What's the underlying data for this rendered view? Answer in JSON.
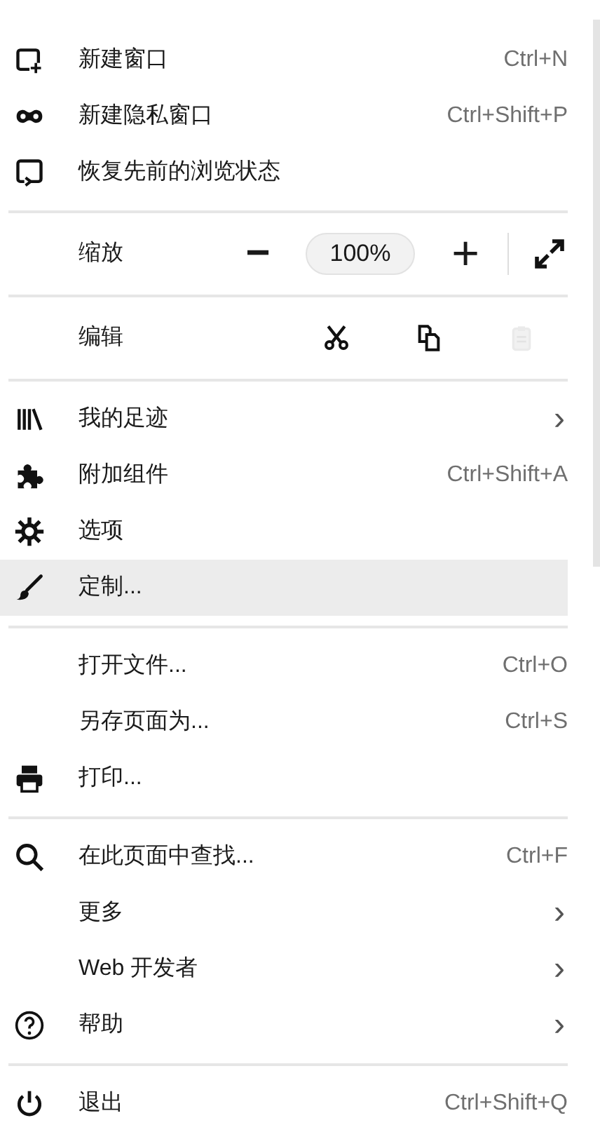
{
  "sections": [
    {
      "rows": [
        {
          "kind": "item",
          "label": "新建窗口",
          "shortcut": "Ctrl+N",
          "selected": false
        },
        {
          "kind": "item",
          "label": "新建隐私窗口",
          "shortcut": "Ctrl+Shift+P",
          "selected": false
        },
        {
          "kind": "item",
          "label": "恢复先前的浏览状态",
          "selected": false
        }
      ]
    },
    {
      "rows": [
        {
          "kind": "zoom",
          "label": "缩放",
          "minus": "−",
          "value": "100%",
          "plus": "+"
        }
      ]
    },
    {
      "rows": [
        {
          "kind": "edit",
          "label": "编辑",
          "buttons": [
            {
              "disabled": false
            },
            {
              "disabled": false
            },
            {
              "disabled": true
            }
          ]
        }
      ]
    },
    {
      "rows": [
        {
          "kind": "item",
          "label": "我的足迹",
          "arrow": "›",
          "selected": false
        },
        {
          "kind": "item",
          "label": "附加组件",
          "shortcut": "Ctrl+Shift+A",
          "selected": false
        },
        {
          "kind": "item",
          "label": "选项",
          "selected": false
        },
        {
          "kind": "item",
          "label": "定制...",
          "selected": true
        }
      ]
    },
    {
      "rows": [
        {
          "kind": "item",
          "label": "打开文件...",
          "shortcut": "Ctrl+O",
          "selected": false
        },
        {
          "kind": "item",
          "label": "另存页面为...",
          "shortcut": "Ctrl+S",
          "selected": false
        },
        {
          "kind": "item",
          "label": "打印...",
          "selected": false
        }
      ]
    },
    {
      "rows": [
        {
          "kind": "item",
          "label": "在此页面中查找...",
          "shortcut": "Ctrl+F",
          "selected": false
        },
        {
          "kind": "item",
          "label": "更多",
          "arrow": "›",
          "selected": false
        },
        {
          "kind": "item",
          "label": "Web 开发者",
          "arrow": "›",
          "selected": false
        },
        {
          "kind": "item",
          "label": "帮助",
          "arrow": "›",
          "selected": false
        }
      ]
    },
    {
      "rows": [
        {
          "kind": "item",
          "label": "退出",
          "shortcut": "Ctrl+Shift+Q",
          "selected": false
        }
      ]
    }
  ]
}
